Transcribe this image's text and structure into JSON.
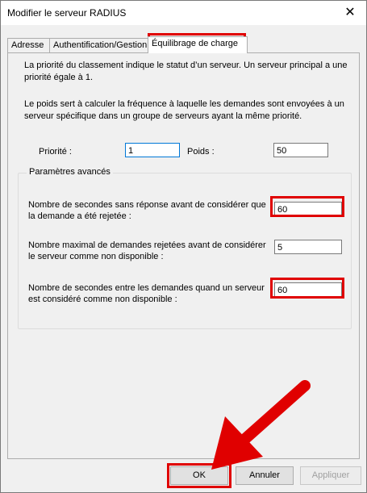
{
  "window": {
    "title": "Modifier le serveur RADIUS",
    "close_glyph": "✕"
  },
  "tabs": [
    {
      "label": "Adresse",
      "active": false
    },
    {
      "label": "Authentification/Gestion",
      "active": false
    },
    {
      "label": "Équilibrage de charge",
      "active": true
    }
  ],
  "panel": {
    "desc1": "La priorité du classement indique le statut d’un serveur. Un serveur principal a une priorité égale à 1.",
    "desc2": "Le poids sert à calculer la fréquence à laquelle les demandes sont envoyées à un serveur spécifique dans un groupe de serveurs ayant la même priorité.",
    "priority_label": "Priorité :",
    "priority_value": "1",
    "weight_label": "Poids :",
    "weight_value": "50",
    "advanced": {
      "title": "Paramètres avancés",
      "timeout_label": "Nombre de secondes sans réponse avant de considérer que la demande a été rejetée :",
      "timeout_value": "60",
      "max_rejected_label": "Nombre maximal de demandes rejetées avant de considérer le serveur comme non disponible :",
      "max_rejected_value": "5",
      "interval_label": "Nombre de secondes entre les demandes quand un serveur est considéré comme non disponible :",
      "interval_value": "60"
    }
  },
  "buttons": {
    "ok": "OK",
    "cancel": "Annuler",
    "apply": "Appliquer"
  },
  "colors": {
    "highlight": "#e00000",
    "focus_border": "#0078d7"
  }
}
